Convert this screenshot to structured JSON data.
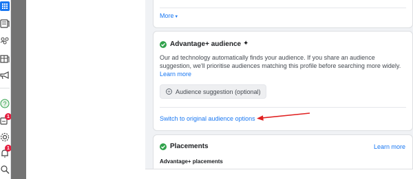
{
  "colors": {
    "accent": "#1877f2",
    "success": "#31a24c",
    "notification": "#e41e3f",
    "annotation_arrow": "#e02020"
  },
  "sidebar": {
    "icons": [
      {
        "name": "grid-icon",
        "active": true
      },
      {
        "name": "pages-icon"
      },
      {
        "name": "audience-people-icon"
      },
      {
        "name": "catalog-icon"
      },
      {
        "name": "megaphone-icon"
      },
      {
        "name": "help-icon"
      },
      {
        "name": "notifications-box-icon",
        "badge": "1"
      },
      {
        "name": "settings-icon"
      },
      {
        "name": "bell-icon",
        "badge": "1"
      },
      {
        "name": "search-icon"
      }
    ]
  },
  "top_card": {
    "more_label": "More",
    "more_caret": "▾"
  },
  "audience_card": {
    "title": "Advantage+ audience",
    "sparkle": "✦",
    "description": "Our ad technology automatically finds your audience. If you share an audience suggestion, we'll prioritise audiences matching this profile before searching more widely.",
    "learn_more": "Learn more",
    "suggestion_button": "Audience suggestion (optional)",
    "switch_link": "Switch to original audience options"
  },
  "placements_card": {
    "title": "Placements",
    "learn_more": "Learn more",
    "subheading": "Advantage+ placements"
  }
}
